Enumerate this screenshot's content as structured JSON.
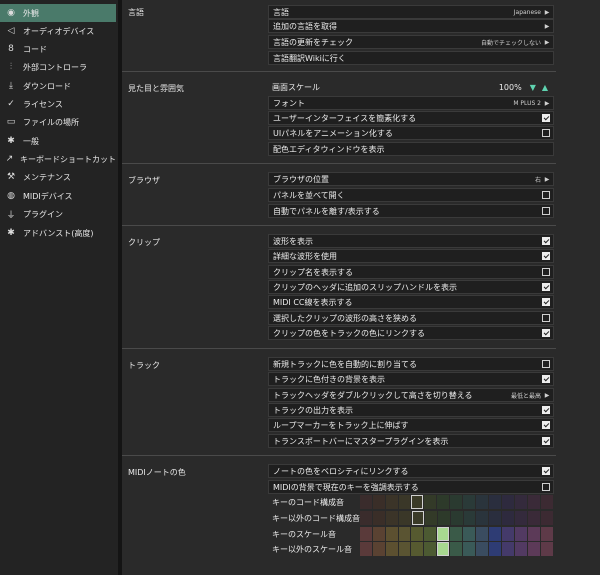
{
  "sidebar": {
    "items": [
      {
        "label": "外観",
        "icon": "eye-icon",
        "glyph": "◉",
        "active": true
      },
      {
        "label": "オーディオデバイス",
        "icon": "speaker-icon",
        "glyph": "◁",
        "active": false
      },
      {
        "label": "コード",
        "icon": "code-icon",
        "glyph": "8",
        "active": false
      },
      {
        "label": "外部コントローラ",
        "icon": "sliders-icon",
        "glyph": "⫶",
        "active": false
      },
      {
        "label": "ダウンロード",
        "icon": "download-icon",
        "glyph": "⤓",
        "active": false
      },
      {
        "label": "ライセンス",
        "icon": "key-icon",
        "glyph": "✓",
        "active": false
      },
      {
        "label": "ファイルの場所",
        "icon": "folder-icon",
        "glyph": "▭",
        "active": false
      },
      {
        "label": "一般",
        "icon": "gear-icon",
        "glyph": "✱",
        "active": false
      },
      {
        "label": "キーボードショートカット",
        "icon": "external-link-icon",
        "glyph": "↗",
        "active": false
      },
      {
        "label": "メンテナンス",
        "icon": "wrench-icon",
        "glyph": "⚒",
        "active": false
      },
      {
        "label": "MIDIデバイス",
        "icon": "midi-icon",
        "glyph": "◍",
        "active": false
      },
      {
        "label": "プラグイン",
        "icon": "plug-icon",
        "glyph": "⏚",
        "active": false
      },
      {
        "label": "アドバンスト(高度)",
        "icon": "advanced-gear-icon",
        "glyph": "✱",
        "active": false
      }
    ]
  },
  "sections": {
    "language": {
      "title": "言語",
      "rows": [
        {
          "label": "言語",
          "value": "Japanese"
        },
        {
          "label": "追加の言語を取得"
        },
        {
          "label": "言語の更新をチェック",
          "value": "自動でチェックしない"
        },
        {
          "label": "言語翻訳Wikiに行く"
        }
      ]
    },
    "appearance": {
      "title": "見た目と雰囲気",
      "scale_label": "画面スケール",
      "scale_value": "100%",
      "font_label": "フォント",
      "font_value": "M PLUS 2",
      "rows": [
        {
          "label": "ユーザーインターフェイスを簡素化する",
          "checked": true
        },
        {
          "label": "UIパネルをアニメーション化する",
          "checked": false
        },
        {
          "label": "配色エディタウィンドウを表示"
        }
      ]
    },
    "browser": {
      "title": "ブラウザ",
      "position_label": "ブラウザの位置",
      "position_value": "右",
      "rows": [
        {
          "label": "パネルを並べて開く",
          "checked": false
        },
        {
          "label": "自動でパネルを離す/表示する",
          "checked": false
        }
      ]
    },
    "clip": {
      "title": "クリップ",
      "rows": [
        {
          "label": "波形を表示",
          "checked": true
        },
        {
          "label": "詳細な波形を使用",
          "checked": true
        },
        {
          "label": "クリップ名を表示する",
          "checked": false
        },
        {
          "label": "クリップのヘッダに追加のスリップハンドルを表示",
          "checked": true
        },
        {
          "label": "MIDI CC線を表示する",
          "checked": true
        },
        {
          "label": "選択したクリップの波形の高さを狭める",
          "checked": false
        },
        {
          "label": "クリップの色をトラックの色にリンクする",
          "checked": true
        }
      ]
    },
    "track": {
      "title": "トラック",
      "rows": [
        {
          "label": "新規トラックに色を自動的に割り当てる",
          "checked": false
        },
        {
          "label": "トラックに色付きの背景を表示",
          "checked": true
        },
        {
          "label": "トラックヘッダをダブルクリックして高さを切り替える",
          "value": "最低と最高"
        },
        {
          "label": "トラックの出力を表示",
          "checked": true
        },
        {
          "label": "ループマーカーをトラック上に伸ばす",
          "checked": true
        },
        {
          "label": "トランスポートバーにマスタープラグインを表示",
          "checked": true
        }
      ]
    },
    "midi": {
      "title": "MIDIノートの色",
      "rows": [
        {
          "label": "ノートの色をベロシティにリンクする",
          "checked": true
        },
        {
          "label": "MIDIの背景で現在のキーを強調表示する",
          "checked": false
        }
      ],
      "swatch_rows": [
        {
          "label": "キーのコード構成音",
          "colors": [
            "#3a2c2c",
            "#3a2e28",
            "#3b3428",
            "#3a3728",
            "#3a3a28",
            "#333a28",
            "#2d3a2a",
            "#2a3a30",
            "#2a3a38",
            "#2a343c",
            "#2a2e3e",
            "#2e2a3e",
            "#342a3c",
            "#3a2a38",
            "#3c2a32"
          ],
          "selected": 4
        },
        {
          "label": "キー以外のコード構成音",
          "colors": [
            "#3a2c2c",
            "#3a2e28",
            "#3b3428",
            "#3a3728",
            "#3a3a28",
            "#333a28",
            "#2d3a2a",
            "#2a3a30",
            "#2a3a38",
            "#2a343c",
            "#2a2e3e",
            "#2e2a3e",
            "#342a3c",
            "#3a2a38",
            "#3c2a32"
          ],
          "selected": 4
        },
        {
          "label": "キーのスケール音",
          "colors": [
            "#5a3a3a",
            "#5a4232",
            "#5c5030",
            "#5a5432",
            "#565a30",
            "#4c5a32",
            "#a8d890",
            "#3a5a48",
            "#3a5a58",
            "#3a4c60",
            "#2e3c74",
            "#443a6a",
            "#523a62",
            "#5c3a58",
            "#5e3a48"
          ],
          "selected": 6
        },
        {
          "label": "キー以外のスケール音",
          "colors": [
            "#5a3a3a",
            "#5a4232",
            "#5c5030",
            "#5a5432",
            "#565a30",
            "#4c5a32",
            "#a8d890",
            "#3a5a48",
            "#3a5a58",
            "#3a4c60",
            "#2e3c74",
            "#443a6a",
            "#523a62",
            "#5c3a58",
            "#5e3a48"
          ],
          "selected": 6
        }
      ]
    }
  }
}
